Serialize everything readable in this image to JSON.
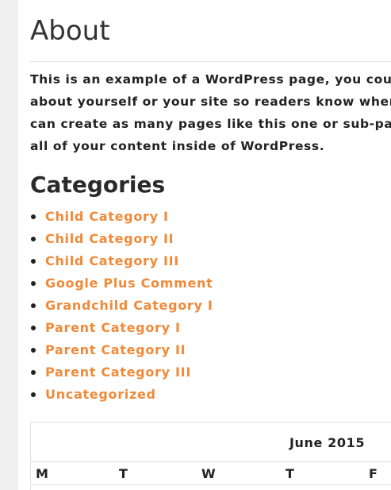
{
  "page": {
    "title": "About",
    "intro_lines": [
      "This is an example of a WordPress page, you could",
      "about yourself or your site so readers know where",
      "can create as many pages like this one or sub-pages",
      "all of your content inside of WordPress."
    ]
  },
  "categories_widget": {
    "title": "Categories",
    "items": [
      "Child Category I",
      "Child Category II",
      "Child Category III",
      "Google Plus Comment",
      "Grandchild Category I",
      "Parent Category I",
      "Parent Category II",
      "Parent Category III",
      "Uncategorized"
    ]
  },
  "calendar": {
    "caption": "June 2015",
    "weekdays": [
      "M",
      "T",
      "W",
      "T",
      "F"
    ]
  },
  "colors": {
    "link": "#f08a3a",
    "text": "#222222",
    "background": "#ffffff",
    "gutter": "#f0f0f0"
  }
}
